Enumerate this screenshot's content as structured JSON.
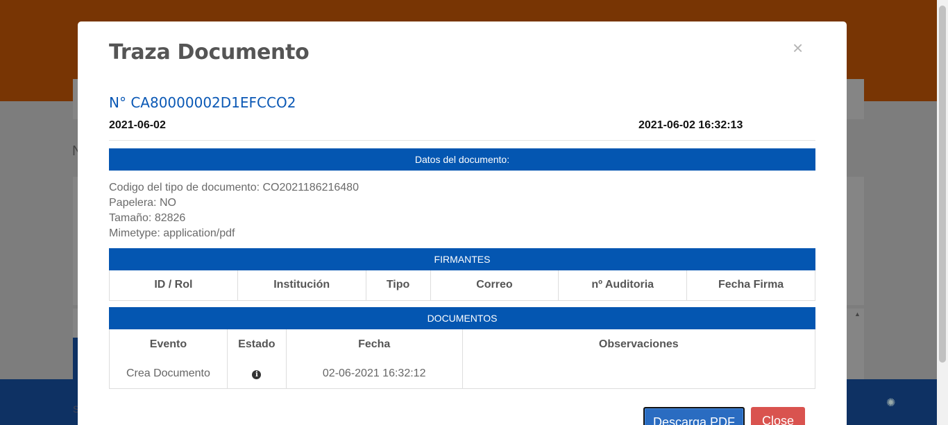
{
  "modal": {
    "title": "Traza Documento",
    "close_symbol": "×",
    "doc_number": "N° CA80000002D1EFCCO2",
    "date": "2021-06-02",
    "datetime": "2021-06-02 16:32:13",
    "sections": {
      "datos": "Datos del documento:",
      "firmantes": "FIRMANTES",
      "documentos": "DOCUMENTOS"
    },
    "details": [
      "Codigo del tipo de documento: CO2021186216480",
      "Papelera: NO",
      "Tamaño: 82826",
      "Mimetype: application/pdf"
    ],
    "firmantes_headers": [
      "ID / Rol",
      "Institución",
      "Tipo",
      "Correo",
      "nº Auditoria",
      "Fecha Firma"
    ],
    "documentos_headers": [
      "Evento",
      "Estado",
      "Fecha",
      "Observaciones"
    ],
    "documentos_rows": [
      {
        "evento": "Crea Documento",
        "estado_icon": "info-circle-icon",
        "fecha": "02-06-2021 16:32:12",
        "observaciones": ""
      }
    ],
    "buttons": {
      "pdf": "Descarga PDF",
      "close": "Close"
    }
  },
  "background": {
    "header_color": "#783504",
    "footer_color": "#0e3163"
  },
  "colors": {
    "accent_blue": "#0456b1",
    "link_blue": "#0a58b5",
    "danger_red": "#d9534f"
  }
}
